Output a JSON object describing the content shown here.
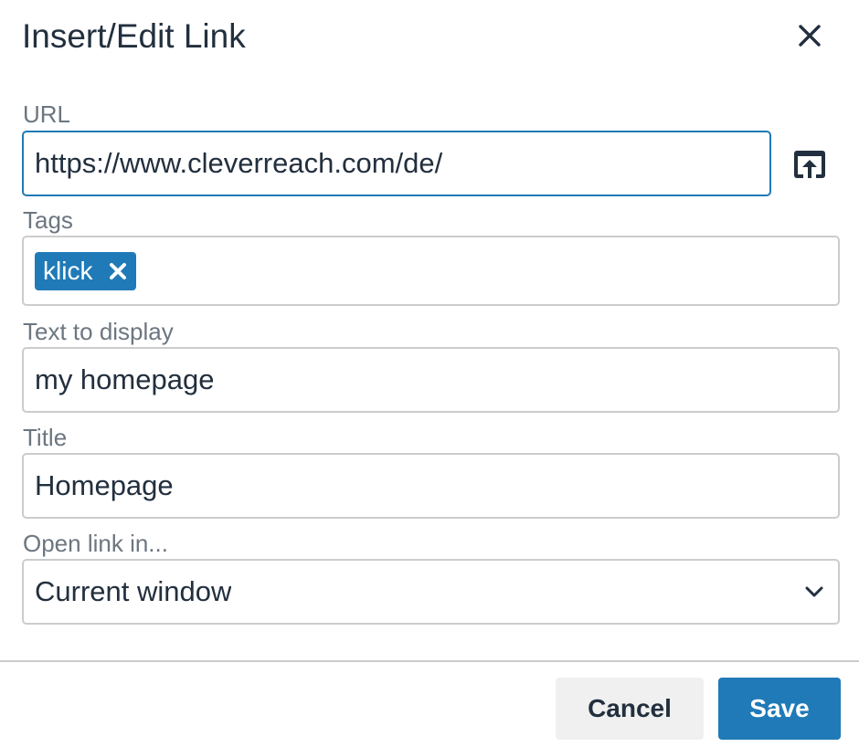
{
  "dialog": {
    "title": "Insert/Edit Link",
    "close_icon": "close-icon"
  },
  "url": {
    "label": "URL",
    "value": "https://www.cleverreach.com/de/",
    "browse_icon": "browse-upload-icon"
  },
  "tags": {
    "label": "Tags",
    "items": [
      {
        "label": "klick",
        "remove_icon": "close-icon"
      }
    ]
  },
  "text_to_display": {
    "label": "Text to display",
    "value": "my homepage"
  },
  "title_field": {
    "label": "Title",
    "value": "Homepage"
  },
  "open_link_in": {
    "label": "Open link in...",
    "selected": "Current window",
    "chevron_icon": "chevron-down-icon"
  },
  "footer": {
    "cancel_label": "Cancel",
    "save_label": "Save"
  },
  "colors": {
    "accent": "#207ab7",
    "text": "#222f3e",
    "label": "#6c7680",
    "border": "#cccccc",
    "cancel_bg": "#f0f0f0"
  }
}
